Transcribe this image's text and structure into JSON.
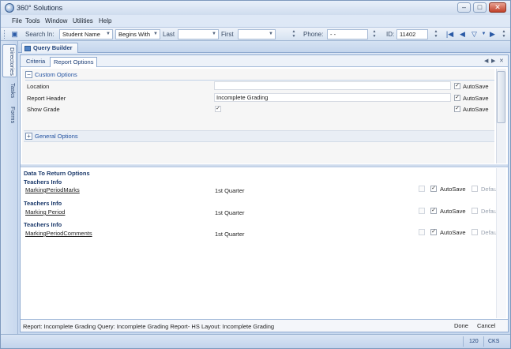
{
  "app": {
    "title": "360° Solutions"
  },
  "window_controls": {
    "minimize": "–",
    "maximize": "□",
    "close": "✕"
  },
  "menu": [
    "File",
    "Tools",
    "Window",
    "Utilities",
    "Help"
  ],
  "toolbar": {
    "search_in_label": "Search In:",
    "search_in_value": "Student Name",
    "match_value": "Begins With",
    "last_label": "Last",
    "last_value": "",
    "first_label": "First",
    "first_value": "",
    "phone_label": "Phone:",
    "phone_value": "-   -",
    "id_label": "ID:",
    "id_value": "11402"
  },
  "left_tabs": [
    "Directories",
    "Tasks",
    "Forms"
  ],
  "document_tab": "Query Builder",
  "subtabs": {
    "criteria": "Criteria",
    "report_options": "Report Options"
  },
  "custom_options": {
    "header": "Custom Options",
    "rows": [
      {
        "label": "Location",
        "value": "",
        "autosave_label": "AutoSave",
        "autosave_checked": "✓"
      },
      {
        "label": "Report Header",
        "value": "Incomplete Grading",
        "autosave_label": "AutoSave",
        "autosave_checked": "✓"
      },
      {
        "label": "Show Grade",
        "value": "✓",
        "autosave_label": "AutoSave",
        "autosave_checked": "✓"
      }
    ]
  },
  "general_options": {
    "header": "General Options"
  },
  "data_to_return": {
    "title": "Data To Return Options",
    "groups": [
      {
        "heading": "Teachers Info",
        "link": "MarkingPeriodMarks",
        "value": "1st Quarter",
        "autosave_label": "AutoSave",
        "autosave_checked": "✓",
        "default_label": "Default"
      },
      {
        "heading": "Teachers Info",
        "link": "Marking Period",
        "value": "1st Quarter",
        "autosave_label": "AutoSave",
        "autosave_checked": "✓",
        "default_label": "Default"
      },
      {
        "heading": "Teachers Info",
        "link": "MarkingPeriodComments",
        "value": "1st Quarter",
        "autosave_label": "AutoSave",
        "autosave_checked": "✓",
        "default_label": "Default"
      }
    ]
  },
  "status": {
    "text": "Report: Incomplete Grading   Query: Incomplete Grading Report- HS   Layout: Incomplete Grading",
    "done": "Done",
    "cancel": "Cancel"
  },
  "bottom": {
    "number": "120",
    "code": "CKS"
  },
  "colors": {
    "accent": "#2050a0",
    "frame": "#c9daf0"
  }
}
